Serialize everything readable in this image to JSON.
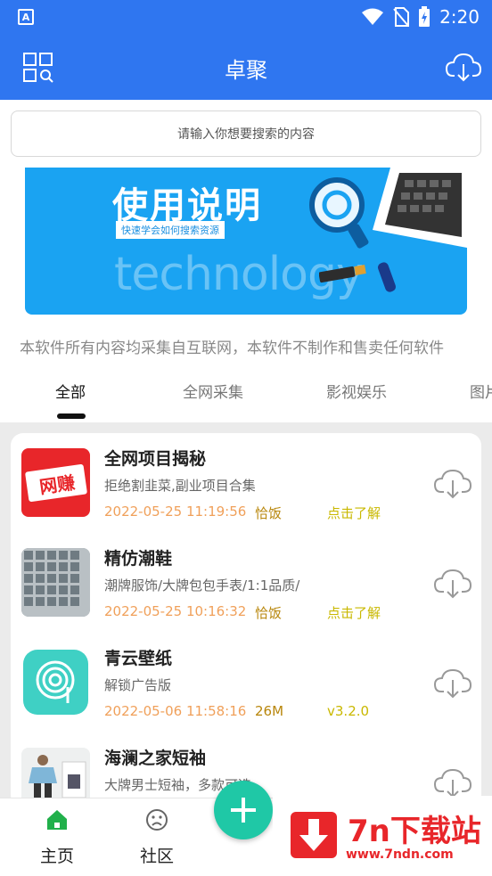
{
  "status_bar": {
    "time": "2:20",
    "left_icon_letter": "A"
  },
  "app_bar": {
    "title": "卓聚",
    "left_icon": "grid-search-icon",
    "right_icon": "cloud-download-icon"
  },
  "search": {
    "placeholder": "请输入你想要搜索的内容"
  },
  "banner": {
    "title": "使用说明",
    "subtitle": "快速学会如何搜索资源",
    "word": "technology"
  },
  "notice": "本软件所有内容均采集自互联网，本软件不制作和售卖任何软件",
  "tabs": [
    {
      "label": "全部",
      "active": true
    },
    {
      "label": "全网采集",
      "active": false
    },
    {
      "label": "影视娱乐",
      "active": false
    },
    {
      "label": "图片",
      "active": false
    }
  ],
  "items": [
    {
      "title": "全网项目揭秘",
      "desc": "拒绝割韭菜,副业项目合集",
      "date": "2022-05-25 11:19:56",
      "meta": "恰饭",
      "action": "点击了解",
      "thumb_text": "网赚"
    },
    {
      "title": "精仿潮鞋",
      "desc": "潮牌服饰/大牌包包手表/1:1品质/",
      "date": "2022-05-25 10:16:32",
      "meta": "恰饭",
      "action": "点击了解",
      "thumb_text": ""
    },
    {
      "title": "青云壁纸",
      "desc": "解锁广告版",
      "date": "2022-05-06 11:58:16",
      "meta": "26M",
      "action": "v3.2.0",
      "thumb_text": ""
    },
    {
      "title": "海澜之家短袖",
      "desc": "大牌男士短袖，多款可选",
      "date": "",
      "meta": "",
      "action": "",
      "thumb_text": ""
    }
  ],
  "bottom_nav": {
    "home_label": "主页",
    "community_label": "社区"
  },
  "watermark": {
    "title": "7n下载站",
    "url": "www.7ndn.com"
  },
  "colors": {
    "primary": "#2f76f0",
    "fab": "#1fc8a6",
    "date": "#f0a05a",
    "watermark": "#e8262a"
  }
}
